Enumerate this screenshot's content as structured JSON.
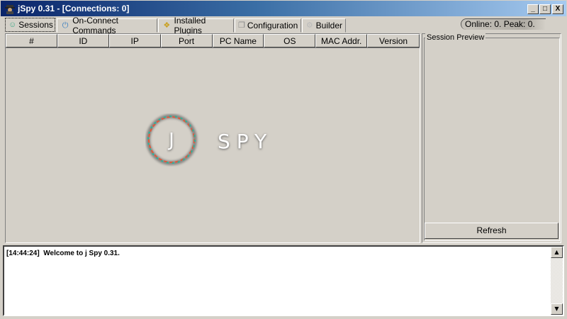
{
  "window": {
    "title": "jSpy 0.31 - [Connections: 0]",
    "minimize": "_",
    "maximize": "□",
    "close": "X"
  },
  "tabs": [
    {
      "label": "Sessions",
      "icon": "users-icon"
    },
    {
      "label": "On-Connect Commands",
      "icon": "power-icon"
    },
    {
      "label": "Installed Plugins",
      "icon": "puzzle-icon"
    },
    {
      "label": "Configuration",
      "icon": "config-icon"
    },
    {
      "label": "Builder",
      "icon": "gear-icon"
    }
  ],
  "status": "Online: 0. Peak: 0.",
  "table": {
    "columns": [
      "#",
      "ID",
      "IP",
      "Port",
      "PC Name",
      "OS",
      "MAC Addr.",
      "Version"
    ]
  },
  "logo": {
    "letter": "J",
    "word": "SPY"
  },
  "preview": {
    "label": "Session Preview",
    "refresh": "Refresh"
  },
  "log": {
    "lines": [
      {
        "time": "[14:44:24]",
        "text": "Welcome to j Spy 0.31."
      }
    ]
  },
  "colors": {
    "ring_teal": "#2ab39b",
    "ring_red": "#e0583a"
  }
}
